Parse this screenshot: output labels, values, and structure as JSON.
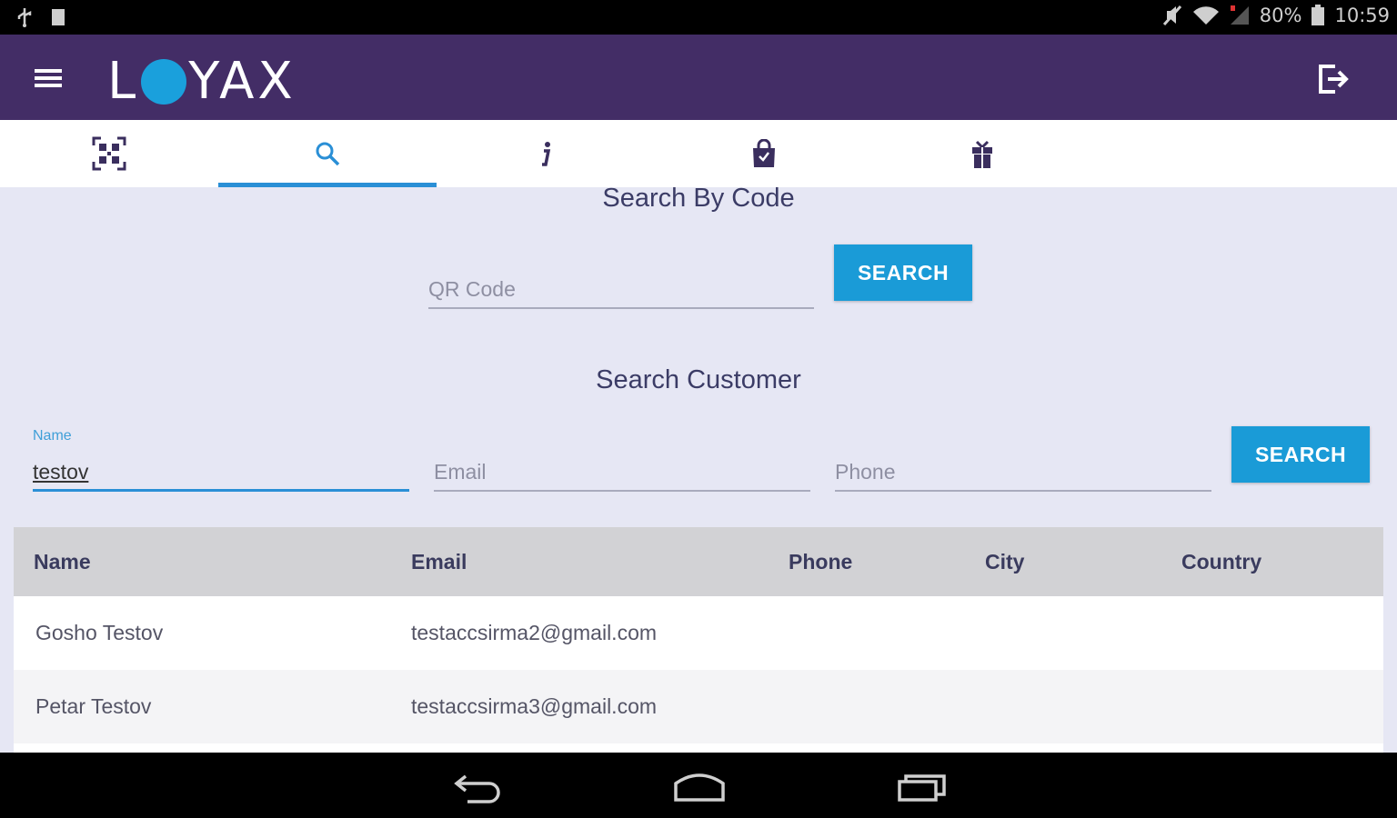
{
  "status_bar": {
    "battery_percent": "80%",
    "time": "10:59",
    "icons": [
      "usb-icon",
      "notification-icon",
      "mute-icon",
      "wifi-icon",
      "signal-icon",
      "battery-icon"
    ]
  },
  "app_bar": {
    "logo_left": "L",
    "logo_right": "YAX",
    "colors": {
      "bar": "#432d66",
      "logo_dot": "#1aa0dc"
    }
  },
  "tabs": [
    {
      "icon": "qr-scan-icon",
      "active": false
    },
    {
      "icon": "search-icon",
      "active": true
    },
    {
      "icon": "info-icon",
      "active": false
    },
    {
      "icon": "shopping-bag-icon",
      "active": false
    },
    {
      "icon": "gift-icon",
      "active": false
    }
  ],
  "search_by_code": {
    "title": "Search By Code",
    "qr_placeholder": "QR Code",
    "qr_value": "",
    "button_label": "SEARCH"
  },
  "search_customer": {
    "title": "Search Customer",
    "name_label": "Name",
    "name_value": "testov",
    "email_placeholder": "Email",
    "phone_placeholder": "Phone",
    "button_label": "SEARCH"
  },
  "results_table": {
    "columns": [
      "Name",
      "Email",
      "Phone",
      "City",
      "Country"
    ],
    "rows": [
      {
        "name": "Gosho Testov",
        "email": "testaccsirma2@gmail.com",
        "phone": "",
        "city": "",
        "country": ""
      },
      {
        "name": "Petar Testov",
        "email": "testaccsirma3@gmail.com",
        "phone": "",
        "city": "",
        "country": ""
      }
    ]
  },
  "nav_bar": {
    "buttons": [
      "back-icon",
      "home-icon",
      "recents-icon"
    ]
  },
  "accent_color": "#1a9bd7"
}
